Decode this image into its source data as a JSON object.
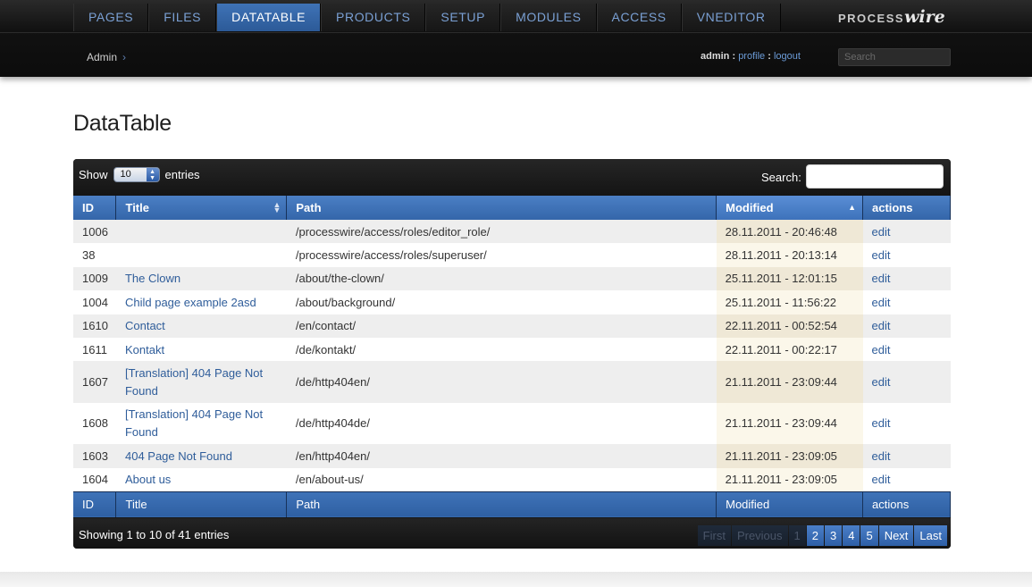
{
  "nav": {
    "items": [
      "PAGES",
      "FILES",
      "DATATABLE",
      "PRODUCTS",
      "SETUP",
      "MODULES",
      "ACCESS",
      "VNEDITOR"
    ],
    "active_index": 2
  },
  "logo": {
    "part1": "PROCESS",
    "part2": "wire"
  },
  "breadcrumb": {
    "label": "Admin",
    "sep": "›"
  },
  "user": {
    "name": "admin",
    "sep1": " : ",
    "profile": "profile",
    "sep2": " : ",
    "logout": "logout"
  },
  "search_top": {
    "placeholder": "Search"
  },
  "page": {
    "title": "DataTable"
  },
  "table": {
    "show_label": "Show",
    "entries_label": "entries",
    "length_value": "10",
    "search_label": "Search:",
    "columns": [
      "ID",
      "Title",
      "Path",
      "Modified",
      "actions"
    ],
    "rows": [
      {
        "id": "1006",
        "title": "",
        "path": "/processwire/access/roles/editor_role/",
        "modified": "28.11.2011 - 20:46:48",
        "action": "edit"
      },
      {
        "id": "38",
        "title": "",
        "path": "/processwire/access/roles/superuser/",
        "modified": "28.11.2011 - 20:13:14",
        "action": "edit"
      },
      {
        "id": "1009",
        "title": "The Clown",
        "path": "/about/the-clown/",
        "modified": "25.11.2011 - 12:01:15",
        "action": "edit"
      },
      {
        "id": "1004",
        "title": "Child page example 2asd",
        "path": "/about/background/",
        "modified": "25.11.2011 - 11:56:22",
        "action": "edit"
      },
      {
        "id": "1610",
        "title": "Contact",
        "path": "/en/contact/",
        "modified": "22.11.2011 - 00:52:54",
        "action": "edit"
      },
      {
        "id": "1611",
        "title": "Kontakt",
        "path": "/de/kontakt/",
        "modified": "22.11.2011 - 00:22:17",
        "action": "edit"
      },
      {
        "id": "1607",
        "title": "[Translation] 404 Page Not Found",
        "path": "/de/http404en/",
        "modified": "21.11.2011 - 23:09:44",
        "action": "edit"
      },
      {
        "id": "1608",
        "title": "[Translation] 404 Page Not Found",
        "path": "/de/http404de/",
        "modified": "21.11.2011 - 23:09:44",
        "action": "edit"
      },
      {
        "id": "1603",
        "title": "404 Page Not Found",
        "path": "/en/http404en/",
        "modified": "21.11.2011 - 23:09:05",
        "action": "edit"
      },
      {
        "id": "1604",
        "title": "About us",
        "path": "/en/about-us/",
        "modified": "21.11.2011 - 23:09:05",
        "action": "edit"
      }
    ],
    "info": "Showing 1 to 10 of 41 entries",
    "pagination": {
      "first": "First",
      "previous": "Previous",
      "pages": [
        "1",
        "2",
        "3",
        "4",
        "5"
      ],
      "current_page": "1",
      "next": "Next",
      "last": "Last"
    }
  },
  "colors": {
    "accent": "#3466aa",
    "active_tab": "#3f73b6",
    "link": "#2f5d9a",
    "masthead": "#111111"
  }
}
